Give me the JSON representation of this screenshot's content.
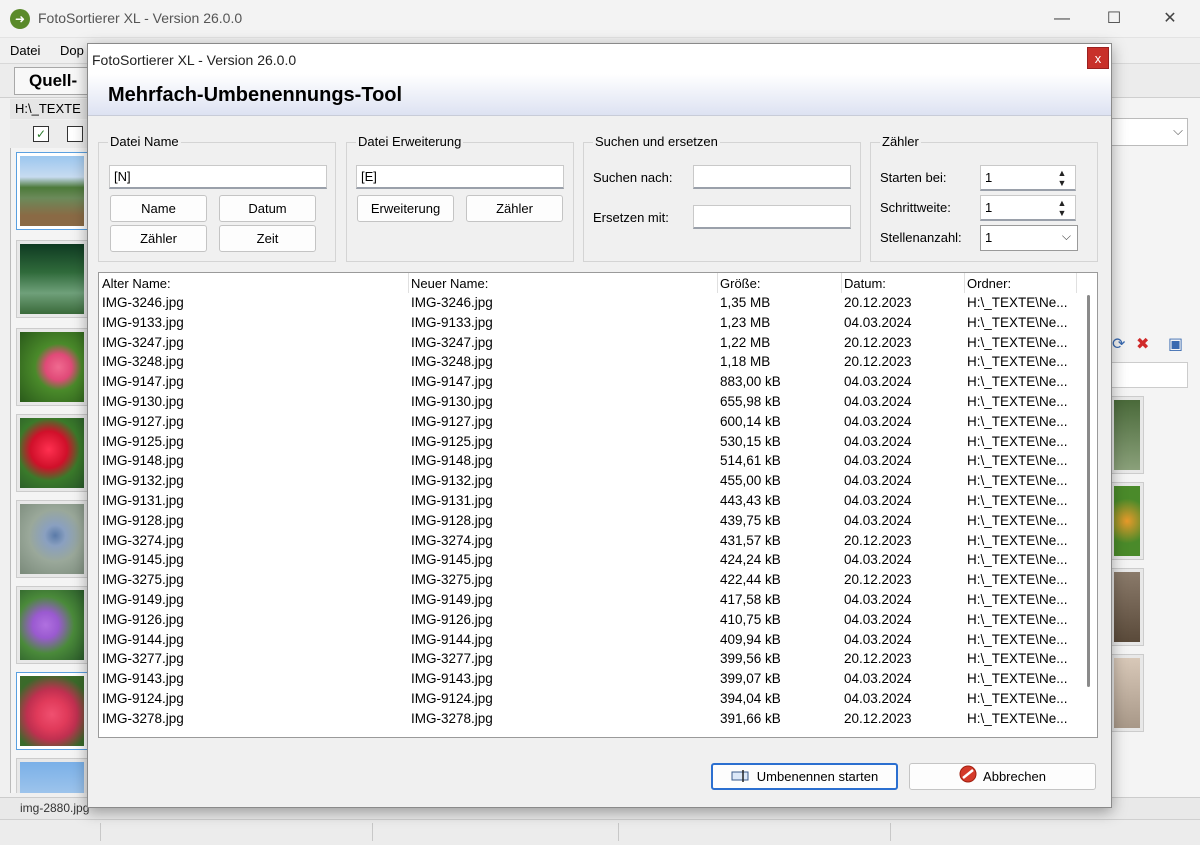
{
  "main_window": {
    "title": "FotoSortierer XL - Version 26.0.0",
    "minimize": "—",
    "maximize": "☐",
    "close": "✕",
    "menu": [
      "Datei",
      "Dop"
    ],
    "toolbar_label": "Quell-",
    "path": "H:\\_TEXTE",
    "status_left": "img-2880.jpg",
    "icons": [
      "app-icon",
      "check-icon",
      "delete-icon",
      "refresh-icon"
    ]
  },
  "dialog": {
    "title": "FotoSortierer XL - Version 26.0.0",
    "close_label": "x",
    "heading": "Mehrfach-Umbenennungs-Tool",
    "filename_group": {
      "label": "Datei Name",
      "value": "[N]",
      "buttons": [
        "Name",
        "Datum",
        "Zähler",
        "Zeit"
      ]
    },
    "extension_group": {
      "label": "Datei Erweiterung",
      "value": "[E]",
      "buttons": [
        "Erweiterung",
        "Zähler"
      ]
    },
    "search_group": {
      "label": "Suchen und ersetzen",
      "search_label": "Suchen nach:",
      "search_value": "",
      "replace_label": "Ersetzen mit:",
      "replace_value": ""
    },
    "counter_group": {
      "label": "Zähler",
      "start_label": "Starten bei:",
      "start_value": "1",
      "step_label": "Schrittweite:",
      "step_value": "1",
      "digits_label": "Stellenanzahl:",
      "digits_value": "1"
    },
    "list": {
      "columns": [
        "Alter Name:",
        "Neuer Name:",
        "Größe:",
        "Datum:",
        "Ordner:"
      ],
      "rows": [
        [
          "IMG-3246.jpg",
          "IMG-3246.jpg",
          "1,35 MB",
          "20.12.2023",
          "H:\\_TEXTE\\Ne..."
        ],
        [
          "IMG-9133.jpg",
          "IMG-9133.jpg",
          "1,23 MB",
          "04.03.2024",
          "H:\\_TEXTE\\Ne..."
        ],
        [
          "IMG-3247.jpg",
          "IMG-3247.jpg",
          "1,22 MB",
          "20.12.2023",
          "H:\\_TEXTE\\Ne..."
        ],
        [
          "IMG-3248.jpg",
          "IMG-3248.jpg",
          "1,18 MB",
          "20.12.2023",
          "H:\\_TEXTE\\Ne..."
        ],
        [
          "IMG-9147.jpg",
          "IMG-9147.jpg",
          "883,00 kB",
          "04.03.2024",
          "H:\\_TEXTE\\Ne..."
        ],
        [
          "IMG-9130.jpg",
          "IMG-9130.jpg",
          "655,98 kB",
          "04.03.2024",
          "H:\\_TEXTE\\Ne..."
        ],
        [
          "IMG-9127.jpg",
          "IMG-9127.jpg",
          "600,14 kB",
          "04.03.2024",
          "H:\\_TEXTE\\Ne..."
        ],
        [
          "IMG-9125.jpg",
          "IMG-9125.jpg",
          "530,15 kB",
          "04.03.2024",
          "H:\\_TEXTE\\Ne..."
        ],
        [
          "IMG-9148.jpg",
          "IMG-9148.jpg",
          "514,61 kB",
          "04.03.2024",
          "H:\\_TEXTE\\Ne..."
        ],
        [
          "IMG-9132.jpg",
          "IMG-9132.jpg",
          "455,00 kB",
          "04.03.2024",
          "H:\\_TEXTE\\Ne..."
        ],
        [
          "IMG-9131.jpg",
          "IMG-9131.jpg",
          "443,43 kB",
          "04.03.2024",
          "H:\\_TEXTE\\Ne..."
        ],
        [
          "IMG-9128.jpg",
          "IMG-9128.jpg",
          "439,75 kB",
          "04.03.2024",
          "H:\\_TEXTE\\Ne..."
        ],
        [
          "IMG-3274.jpg",
          "IMG-3274.jpg",
          "431,57 kB",
          "20.12.2023",
          "H:\\_TEXTE\\Ne..."
        ],
        [
          "IMG-9145.jpg",
          "IMG-9145.jpg",
          "424,24 kB",
          "04.03.2024",
          "H:\\_TEXTE\\Ne..."
        ],
        [
          "IMG-3275.jpg",
          "IMG-3275.jpg",
          "422,44 kB",
          "20.12.2023",
          "H:\\_TEXTE\\Ne..."
        ],
        [
          "IMG-9149.jpg",
          "IMG-9149.jpg",
          "417,58 kB",
          "04.03.2024",
          "H:\\_TEXTE\\Ne..."
        ],
        [
          "IMG-9126.jpg",
          "IMG-9126.jpg",
          "410,75 kB",
          "04.03.2024",
          "H:\\_TEXTE\\Ne..."
        ],
        [
          "IMG-9144.jpg",
          "IMG-9144.jpg",
          "409,94 kB",
          "04.03.2024",
          "H:\\_TEXTE\\Ne..."
        ],
        [
          "IMG-3277.jpg",
          "IMG-3277.jpg",
          "399,56 kB",
          "20.12.2023",
          "H:\\_TEXTE\\Ne..."
        ],
        [
          "IMG-9143.jpg",
          "IMG-9143.jpg",
          "399,07 kB",
          "04.03.2024",
          "H:\\_TEXTE\\Ne..."
        ],
        [
          "IMG-9124.jpg",
          "IMG-9124.jpg",
          "394,04 kB",
          "04.03.2024",
          "H:\\_TEXTE\\Ne..."
        ],
        [
          "IMG-3278.jpg",
          "IMG-3278.jpg",
          "391,66 kB",
          "20.12.2023",
          "H:\\_TEXTE\\Ne..."
        ]
      ]
    },
    "start_button": "Umbenennen starten",
    "cancel_button": "Abbrechen",
    "colors": {
      "close_red": "#c8302a",
      "primary_border": "#2b6fd0"
    }
  }
}
